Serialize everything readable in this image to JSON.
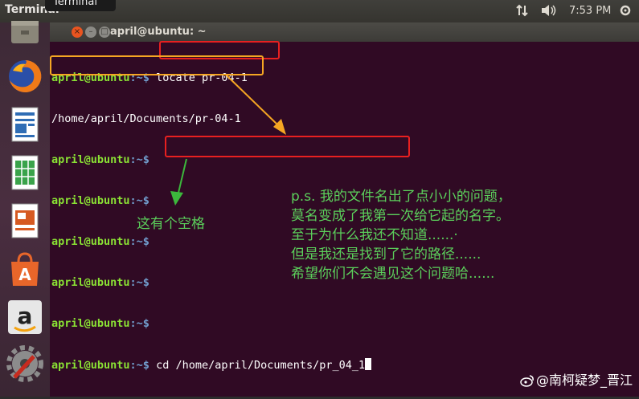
{
  "topbar": {
    "app_title": "Terminal",
    "tooltip": "Terminal",
    "time": "7:53 PM",
    "network_icon": "network-updown-icon",
    "volume_icon": "volume-icon",
    "power_icon": "power-gear-icon"
  },
  "launcher": {
    "items": [
      {
        "name": "files-icon"
      },
      {
        "name": "firefox-icon"
      },
      {
        "name": "writer-icon"
      },
      {
        "name": "calc-icon"
      },
      {
        "name": "impress-icon"
      },
      {
        "name": "software-center-icon"
      },
      {
        "name": "amazon-icon"
      },
      {
        "name": "system-settings-icon"
      }
    ]
  },
  "window": {
    "title": "april@ubuntu: ~",
    "close_glyph": "×",
    "min_glyph": "–",
    "max_glyph": "□"
  },
  "terminal": {
    "prompt_user": "april@ubuntu",
    "prompt_path": ":~$",
    "line1_cmd": " locate pr-04-1",
    "line2_output": "/home/april/Documents/pr-04-1",
    "line_last_cmd": " cd /home/april/Documents/pr_04_1"
  },
  "annotations": {
    "space_note": "这有个空格",
    "note_lines": [
      "p.s. 我的文件名出了点小小的问题，",
      "莫名变成了我第一次给它起的名字。",
      "至于为什么我还不知道......·",
      "但是我还是找到了它的路径......",
      "希望你们不会遇见这个问题哈......"
    ],
    "red_color": "#e82020",
    "orange_color": "#f5a623",
    "green_color": "#3cb83c"
  },
  "watermark": "@南柯疑梦_晋江"
}
